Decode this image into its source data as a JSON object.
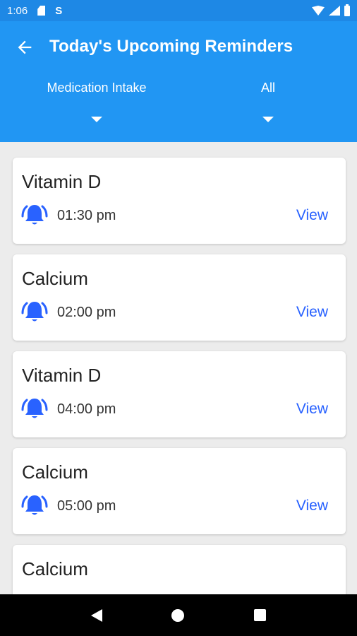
{
  "status_bar": {
    "time": "1:06",
    "s_label": "S"
  },
  "header": {
    "title": "Today's Upcoming Reminders",
    "filters": {
      "type": "Medication Intake",
      "scope": "All"
    }
  },
  "reminders": [
    {
      "name": "Vitamin D",
      "time": "01:30 pm",
      "action": "View"
    },
    {
      "name": "Calcium",
      "time": "02:00 pm",
      "action": "View"
    },
    {
      "name": "Vitamin D",
      "time": "04:00 pm",
      "action": "View"
    },
    {
      "name": "Calcium",
      "time": "05:00 pm",
      "action": "View"
    },
    {
      "name": "Calcium",
      "time": "",
      "action": ""
    }
  ],
  "colors": {
    "app_bar": "#2196f3",
    "status_bar": "#1e88e5",
    "bell": "#2962ff",
    "link": "#2962ff"
  },
  "icons": {
    "back": "arrow-left-icon",
    "bell": "alarm-bell-icon"
  }
}
